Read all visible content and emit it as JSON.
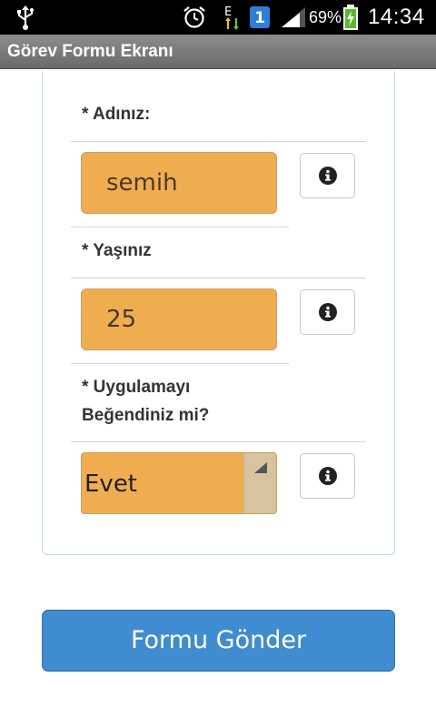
{
  "status_bar": {
    "edge_label": "E",
    "badge_label": "1",
    "battery_percent": "69%",
    "time": "14:34",
    "icons": [
      "usb-icon",
      "alarm-icon",
      "edge-data-icon",
      "notification-badge-icon",
      "signal-icon",
      "battery-charging-icon"
    ]
  },
  "app": {
    "title": "Görev Formu Ekranı"
  },
  "form": {
    "name_label": "* Adınız:",
    "name_value": "semih",
    "age_label": "* Yaşınız",
    "age_value": "25",
    "like_label_line1": "* Uygulamayı",
    "like_label_line2": "Beğendiniz mi?",
    "like_value": "Evet",
    "info_icon": "info-icon"
  },
  "submit": {
    "label": "Formu Gönder"
  },
  "colors": {
    "input_fill": "#f0ad50",
    "submit_fill": "#3f8cd0",
    "card_border": "#b9d9ef"
  }
}
